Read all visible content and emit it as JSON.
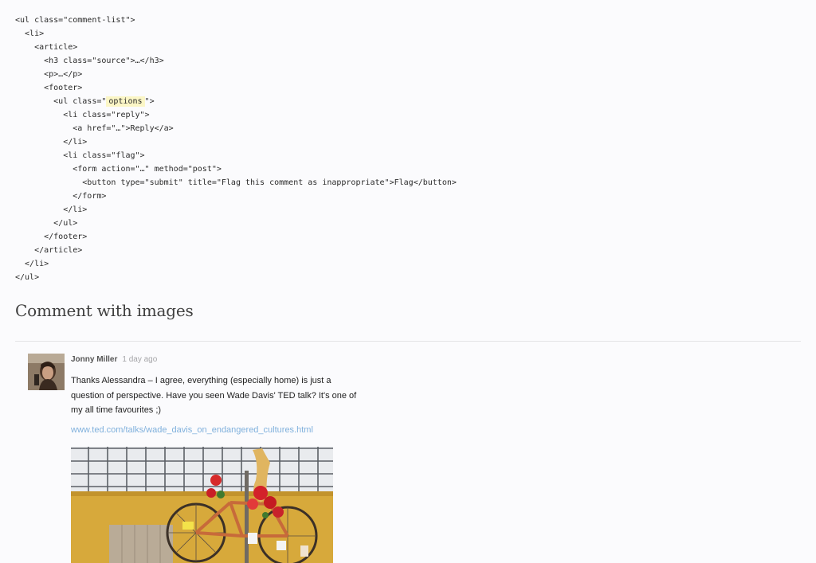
{
  "code_lines": [
    {
      "indent": "",
      "text": "<ul class=\"comment-list\">"
    },
    {
      "indent": "  ",
      "text": "<li>"
    },
    {
      "indent": "    ",
      "text": "<article>"
    },
    {
      "indent": "      ",
      "text": "<h3 class=\"source\">…</h3>"
    },
    {
      "indent": "      ",
      "text": "<p>…</p>"
    },
    {
      "indent": "      ",
      "text": "<footer>"
    },
    {
      "indent": "        ",
      "pre": "<ul class=\"",
      "highlight": "options",
      "post": "\">"
    },
    {
      "indent": "          ",
      "text": "<li class=\"reply\">"
    },
    {
      "indent": "            ",
      "text": "<a href=\"…\">Reply</a>"
    },
    {
      "indent": "          ",
      "text": "</li>"
    },
    {
      "indent": "          ",
      "text": "<li class=\"flag\">"
    },
    {
      "indent": "            ",
      "text": "<form action=\"…\" method=\"post\">"
    },
    {
      "indent": "              ",
      "text": "<button type=\"submit\" title=\"Flag this comment as inappropriate\">Flag</button>"
    },
    {
      "indent": "            ",
      "text": "</form>"
    },
    {
      "indent": "          ",
      "text": "</li>"
    },
    {
      "indent": "        ",
      "text": "</ul>"
    },
    {
      "indent": "      ",
      "text": "</footer>"
    },
    {
      "indent": "    ",
      "text": "</article>"
    },
    {
      "indent": "  ",
      "text": "</li>"
    },
    {
      "indent": "",
      "text": "</ul>"
    }
  ],
  "section": {
    "title": "Comment with images"
  },
  "comment": {
    "avatar_icon": "user-avatar-photo",
    "author": "Jonny Miller",
    "time": "1 day ago",
    "body": "Thanks Alessandra – I agree, everything (especially home) is just a question of perspective. Have you seen Wade Davis' TED talk? It's one of my all time favourites ;)",
    "link": "www.ted.com/talks/wade_davis_on_endangered_cultures.html",
    "image_icon": "bicycle-photo"
  },
  "colors": {
    "highlight": "#fbf6c6",
    "link": "#7fb0dc",
    "background": "#fbfbfd"
  }
}
